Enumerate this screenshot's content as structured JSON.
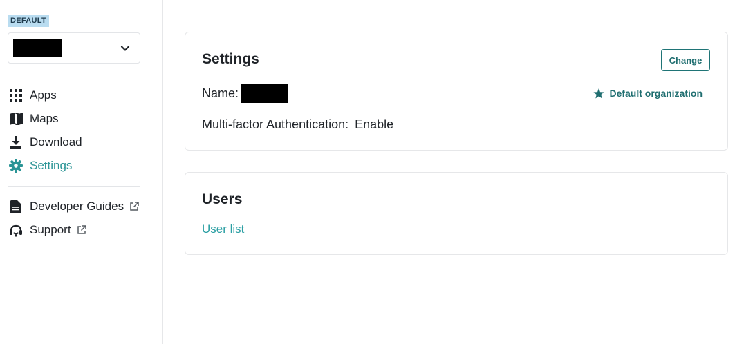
{
  "sidebar": {
    "org_badge": "DEFAULT",
    "nav": [
      {
        "label": "Apps",
        "icon": "grid-icon"
      },
      {
        "label": "Maps",
        "icon": "map-icon"
      },
      {
        "label": "Download",
        "icon": "download-icon"
      },
      {
        "label": "Settings",
        "icon": "gear-icon",
        "active": true
      }
    ],
    "resources": [
      {
        "label": "Developer Guides",
        "icon": "document-icon"
      },
      {
        "label": "Support",
        "icon": "headset-icon"
      }
    ]
  },
  "settings_card": {
    "title": "Settings",
    "change_label": "Change",
    "name_label": "Name:",
    "default_org_label": "Default organization",
    "mfa_label": "Multi-factor Authentication:",
    "mfa_value": "Enable"
  },
  "users_card": {
    "title": "Users",
    "link_label": "User list"
  },
  "colors": {
    "accent": "#2b9596",
    "accent_dark": "#1f6e70",
    "badge_bg": "#b9dcf0",
    "border": "#e6e7e9"
  }
}
